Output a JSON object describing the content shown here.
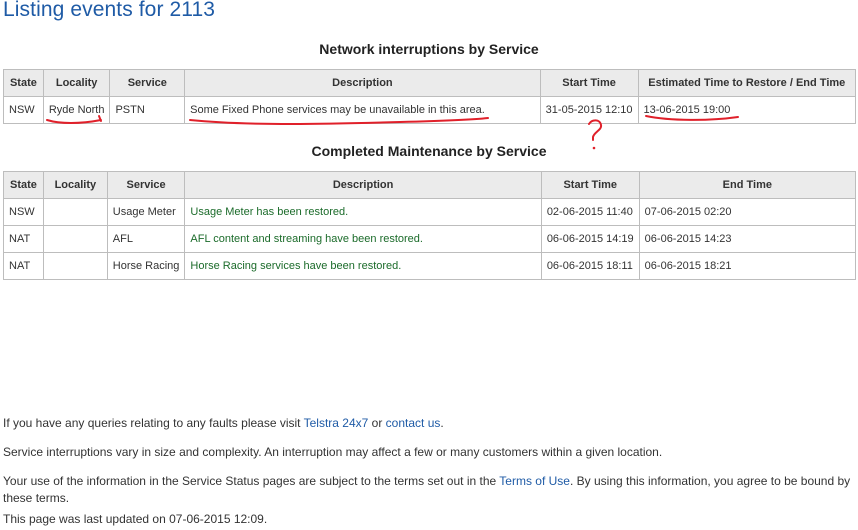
{
  "page_title": "Listing events for 2113",
  "network": {
    "title": "Network interruptions by Service",
    "headers": [
      "State",
      "Locality",
      "Service",
      "Description",
      "Start Time",
      "Estimated Time to Restore / End Time"
    ],
    "rows": [
      {
        "state": "NSW",
        "locality": "Ryde North",
        "service": "PSTN",
        "description": "Some Fixed Phone services may be unavailable in this area.",
        "start": "31-05-2015 12:10",
        "end": "13-06-2015 19:00"
      }
    ]
  },
  "maintenance": {
    "title": "Completed Maintenance by Service",
    "headers": [
      "State",
      "Locality",
      "Service",
      "Description",
      "Start Time",
      "End Time"
    ],
    "rows": [
      {
        "state": "NSW",
        "locality": "",
        "service": "Usage Meter",
        "description": "Usage Meter has been restored.",
        "start": "02-06-2015 11:40",
        "end": "07-06-2015 02:20"
      },
      {
        "state": "NAT",
        "locality": "",
        "service": "AFL",
        "description": "AFL content and streaming have been restored.",
        "start": "06-06-2015 14:19",
        "end": "06-06-2015 14:23"
      },
      {
        "state": "NAT",
        "locality": "",
        "service": "Horse Racing",
        "description": "Horse Racing services have been restored.",
        "start": "06-06-2015 18:11",
        "end": "06-06-2015 18:21"
      }
    ]
  },
  "footer": {
    "line1_prefix": "If you have any queries relating to any faults please visit ",
    "link_telstra": "Telstra 24x7",
    "line1_mid": " or ",
    "link_contact": "contact us",
    "line1_suffix": ".",
    "line2": "Service interruptions vary in size and complexity. An interruption may affect a few or many customers within a given location.",
    "line3_prefix": "Your use of the information in the Service Status pages are subject to the terms set out in the ",
    "link_terms": "Terms of Use",
    "line3_suffix": ". By using this information, you agree to be bound by these terms.",
    "line4": "This page was last updated on 07-06-2015 12:09."
  },
  "colors": {
    "title_blue": "#1f5ba6",
    "header_bg": "#ebebeb",
    "restored_green": "#1b6b2a",
    "annotation_red": "#e0202a"
  }
}
